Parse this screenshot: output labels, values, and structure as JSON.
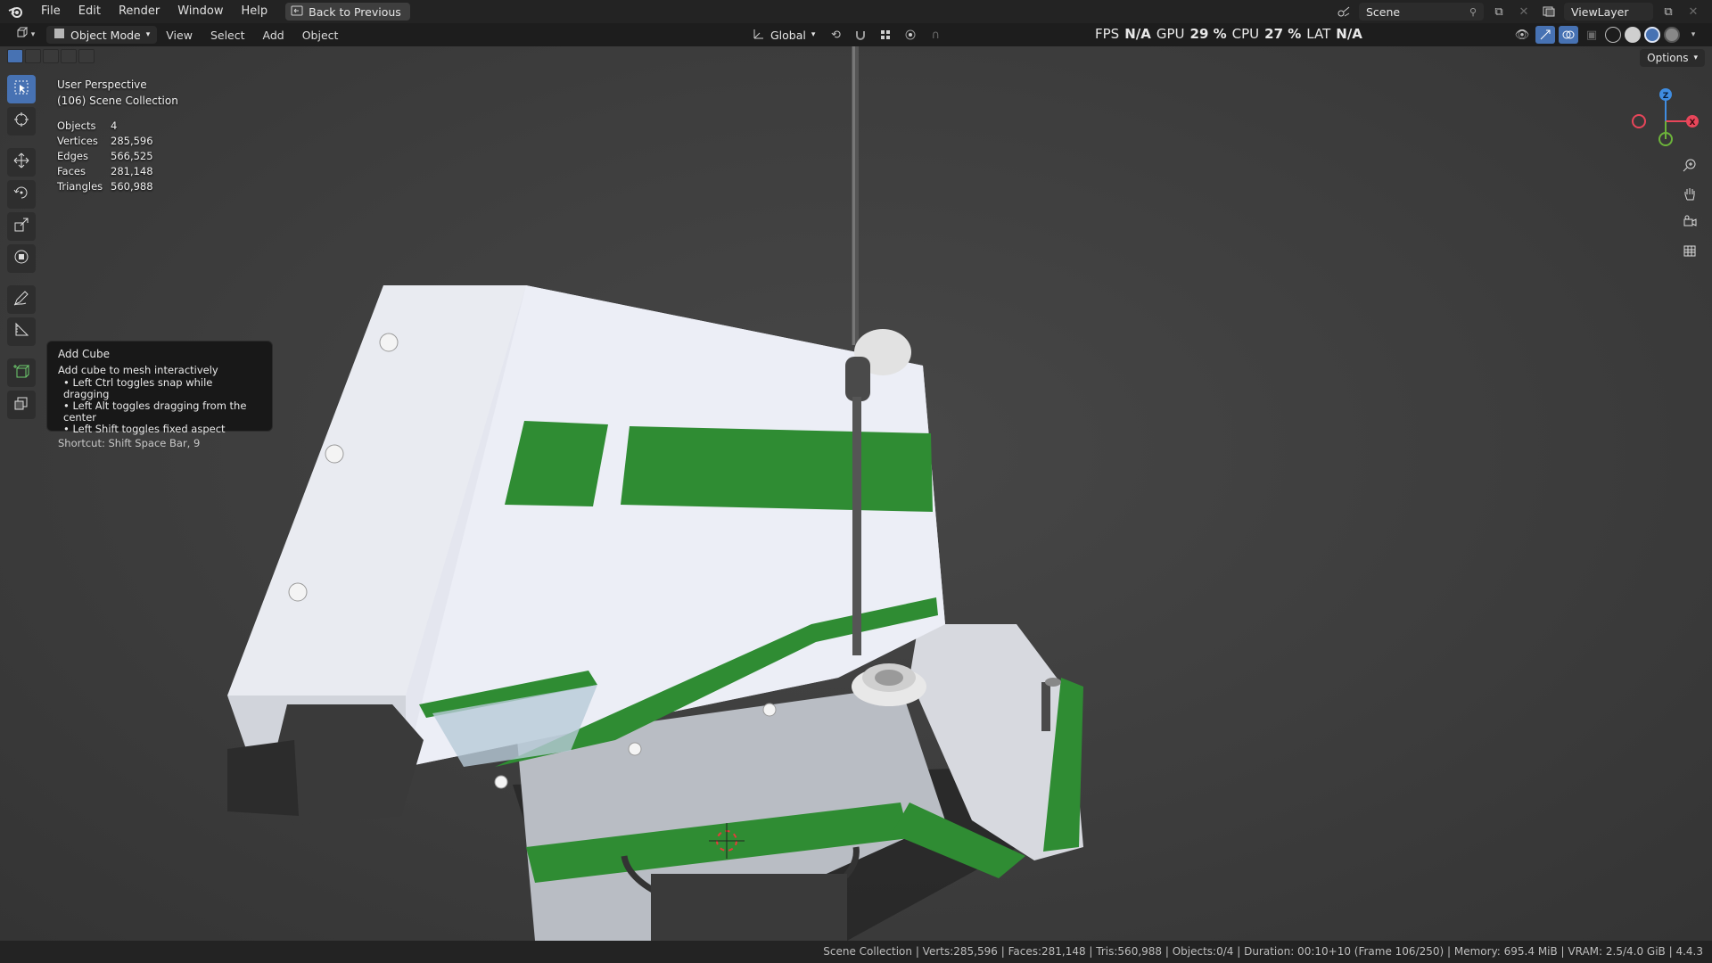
{
  "topbar": {
    "menus": [
      "File",
      "Edit",
      "Render",
      "Window",
      "Help"
    ],
    "back_button": "Back to Previous",
    "scene": "Scene",
    "view_layer": "ViewLayer"
  },
  "viewport_header": {
    "mode": "Object Mode",
    "menus": [
      "View",
      "Select",
      "Add",
      "Object"
    ],
    "orientation": "Global",
    "perf": {
      "fps_label": "FPS",
      "fps_value": "N/A",
      "gpu_label": "GPU",
      "gpu_value": "29 %",
      "cpu_label": "CPU",
      "cpu_value": "27 %",
      "lat_label": "LAT",
      "lat_value": "N/A"
    },
    "options": "Options"
  },
  "overlay": {
    "view_name": "User Perspective",
    "collection": "(106) Scene Collection",
    "stats": [
      {
        "label": "Objects",
        "value": "4"
      },
      {
        "label": "Vertices",
        "value": "285,596"
      },
      {
        "label": "Edges",
        "value": "566,525"
      },
      {
        "label": "Faces",
        "value": "281,148"
      },
      {
        "label": "Triangles",
        "value": "560,988"
      }
    ]
  },
  "tooltip": {
    "title": "Add Cube",
    "description": "Add cube to mesh interactively",
    "bullets": [
      "• Left Ctrl toggles snap while dragging",
      "• Left Alt toggles dragging from the center",
      "• Left Shift toggles fixed aspect"
    ],
    "shortcut": "Shortcut: Shift Space Bar, 9"
  },
  "gizmo": {
    "x": "X",
    "y": "Y",
    "z": "Z"
  },
  "statusbar": {
    "text": "Scene Collection | Verts:285,596 | Faces:281,148 | Tris:560,988 | Objects:0/4 | Duration: 00:10+10 (Frame 106/250) | Memory: 695.4 MiB | VRAM: 2.5/4.0 GiB | 4.4.3"
  },
  "colors": {
    "accent": "#4772b3",
    "model_green": "#2f8c33",
    "model_white": "#e8eaf2",
    "axis_x": "#e8465a",
    "axis_y": "#6cb33a",
    "axis_z": "#3f8ce0"
  }
}
